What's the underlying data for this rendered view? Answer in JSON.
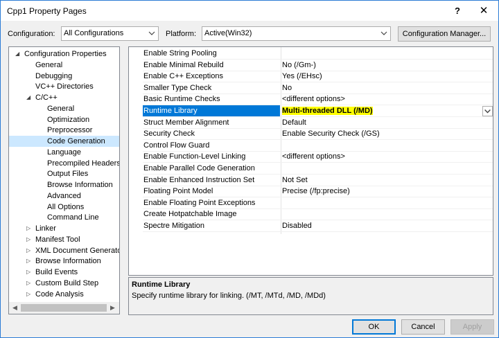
{
  "window": {
    "title": "Cpp1 Property Pages",
    "help_glyph": "?",
    "close_glyph": "✕"
  },
  "config": {
    "configuration_label": "Configuration:",
    "configuration_value": "All Configurations",
    "platform_label": "Platform:",
    "platform_value": "Active(Win32)",
    "manager_button": "Configuration Manager..."
  },
  "tree": [
    {
      "label": "Configuration Properties",
      "level": 0,
      "expander": "open"
    },
    {
      "label": "General",
      "level": 1
    },
    {
      "label": "Debugging",
      "level": 1
    },
    {
      "label": "VC++ Directories",
      "level": 1
    },
    {
      "label": "C/C++",
      "level": 1,
      "expander": "open"
    },
    {
      "label": "General",
      "level": 2
    },
    {
      "label": "Optimization",
      "level": 2
    },
    {
      "label": "Preprocessor",
      "level": 2
    },
    {
      "label": "Code Generation",
      "level": 2,
      "selected": true
    },
    {
      "label": "Language",
      "level": 2
    },
    {
      "label": "Precompiled Headers",
      "level": 2
    },
    {
      "label": "Output Files",
      "level": 2
    },
    {
      "label": "Browse Information",
      "level": 2
    },
    {
      "label": "Advanced",
      "level": 2
    },
    {
      "label": "All Options",
      "level": 2
    },
    {
      "label": "Command Line",
      "level": 2
    },
    {
      "label": "Linker",
      "level": 1,
      "expander": "closed"
    },
    {
      "label": "Manifest Tool",
      "level": 1,
      "expander": "closed"
    },
    {
      "label": "XML Document Generator",
      "level": 1,
      "expander": "closed"
    },
    {
      "label": "Browse Information",
      "level": 1,
      "expander": "closed"
    },
    {
      "label": "Build Events",
      "level": 1,
      "expander": "closed"
    },
    {
      "label": "Custom Build Step",
      "level": 1,
      "expander": "closed"
    },
    {
      "label": "Code Analysis",
      "level": 1,
      "expander": "closed"
    }
  ],
  "properties": [
    {
      "name": "Enable String Pooling",
      "value": ""
    },
    {
      "name": "Enable Minimal Rebuild",
      "value": "No (/Gm-)"
    },
    {
      "name": "Enable C++ Exceptions",
      "value": "Yes (/EHsc)"
    },
    {
      "name": "Smaller Type Check",
      "value": "No"
    },
    {
      "name": "Basic Runtime Checks",
      "value": "<different options>"
    },
    {
      "name": "Runtime Library",
      "value": "Multi-threaded DLL (/MD)",
      "selected": true
    },
    {
      "name": "Struct Member Alignment",
      "value": "Default"
    },
    {
      "name": "Security Check",
      "value": "Enable Security Check (/GS)"
    },
    {
      "name": "Control Flow Guard",
      "value": ""
    },
    {
      "name": "Enable Function-Level Linking",
      "value": "<different options>"
    },
    {
      "name": "Enable Parallel Code Generation",
      "value": ""
    },
    {
      "name": "Enable Enhanced Instruction Set",
      "value": "Not Set"
    },
    {
      "name": "Floating Point Model",
      "value": "Precise (/fp:precise)"
    },
    {
      "name": "Enable Floating Point Exceptions",
      "value": ""
    },
    {
      "name": "Create Hotpatchable Image",
      "value": ""
    },
    {
      "name": "Spectre Mitigation",
      "value": "Disabled"
    }
  ],
  "description": {
    "title": "Runtime Library",
    "text": "Specify runtime library for linking.     (/MT, /MTd, /MD, /MDd)"
  },
  "buttons": {
    "ok": "OK",
    "cancel": "Cancel",
    "apply": "Apply"
  },
  "colors": {
    "selection": "#0078d7",
    "tree_selection": "#cce8ff",
    "highlight": "#ffff00",
    "border_accent": "#2b7bd5"
  }
}
